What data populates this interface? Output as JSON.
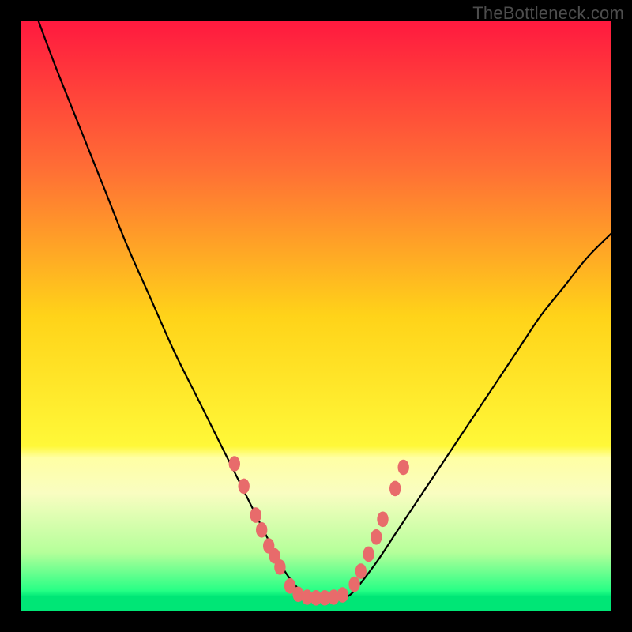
{
  "watermark": "TheBottleneck.com",
  "chart_data": {
    "type": "line",
    "title": "",
    "xlabel": "",
    "ylabel": "",
    "xlim": [
      0,
      100
    ],
    "ylim": [
      0,
      100
    ],
    "background_gradient_stops": [
      {
        "offset": 0.0,
        "color": "#ff193f"
      },
      {
        "offset": 0.25,
        "color": "#ff6e35"
      },
      {
        "offset": 0.5,
        "color": "#ffd319"
      },
      {
        "offset": 0.72,
        "color": "#fff838"
      },
      {
        "offset": 0.74,
        "color": "#ffffa4"
      },
      {
        "offset": 0.8,
        "color": "#f9fdc1"
      },
      {
        "offset": 0.9,
        "color": "#b5ff9a"
      },
      {
        "offset": 0.965,
        "color": "#26ff85"
      },
      {
        "offset": 0.975,
        "color": "#00e676"
      },
      {
        "offset": 1.0,
        "color": "#00e676"
      }
    ],
    "series": [
      {
        "name": "bottleneck-curve",
        "x": [
          3,
          6,
          10,
          14,
          18,
          22,
          26,
          30,
          33,
          36,
          38,
          40,
          42,
          44,
          46,
          48,
          50,
          52,
          54,
          56,
          60,
          64,
          68,
          72,
          76,
          80,
          84,
          88,
          92,
          96,
          100
        ],
        "y": [
          100,
          92,
          82,
          72,
          62,
          53,
          44,
          36,
          30,
          24,
          20,
          16,
          12,
          8,
          5,
          3,
          2.4,
          2.3,
          2.4,
          3,
          8,
          14,
          20,
          26,
          32,
          38,
          44,
          50,
          55,
          60,
          64
        ]
      }
    ],
    "markers": {
      "name": "highlight-dots",
      "color": "#e86b6b",
      "points": [
        {
          "x": 36.2,
          "y": 25.0
        },
        {
          "x": 37.8,
          "y": 21.2
        },
        {
          "x": 39.8,
          "y": 16.3
        },
        {
          "x": 40.8,
          "y": 13.8
        },
        {
          "x": 42.0,
          "y": 11.1
        },
        {
          "x": 43.0,
          "y": 9.4
        },
        {
          "x": 43.9,
          "y": 7.5
        },
        {
          "x": 45.6,
          "y": 4.3
        },
        {
          "x": 47.0,
          "y": 2.9
        },
        {
          "x": 48.5,
          "y": 2.4
        },
        {
          "x": 50.0,
          "y": 2.3
        },
        {
          "x": 51.5,
          "y": 2.3
        },
        {
          "x": 53.0,
          "y": 2.4
        },
        {
          "x": 54.5,
          "y": 2.8
        },
        {
          "x": 56.5,
          "y": 4.6
        },
        {
          "x": 57.6,
          "y": 6.8
        },
        {
          "x": 58.9,
          "y": 9.7
        },
        {
          "x": 60.2,
          "y": 12.6
        },
        {
          "x": 61.3,
          "y": 15.6
        },
        {
          "x": 63.4,
          "y": 20.8
        },
        {
          "x": 64.8,
          "y": 24.4
        }
      ]
    }
  }
}
